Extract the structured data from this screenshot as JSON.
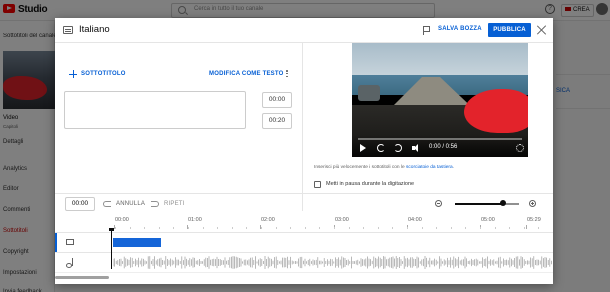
{
  "app": {
    "brand": "Studio",
    "search_placeholder": "Cerca in tutto il tuo canale",
    "help_icon": "?",
    "create_label": "CREA"
  },
  "sidebar": {
    "title": "Sottotitoli del canale",
    "video_label": "Video",
    "video_sub": "Capitoli",
    "items": [
      {
        "label": "Dettagli",
        "active": false
      },
      {
        "label": "Analytics",
        "active": false
      },
      {
        "label": "Editor",
        "active": false
      },
      {
        "label": "Commenti",
        "active": false
      },
      {
        "label": "Sottotitoli",
        "active": true
      },
      {
        "label": "Copyright",
        "active": false
      },
      {
        "label": "Impostazioni",
        "active": false
      },
      {
        "label": "Invia feedback",
        "active": false
      }
    ]
  },
  "background_right": {
    "link": "SICA"
  },
  "modal": {
    "title": "Italiano",
    "save_draft": "SALVA BOZZA",
    "publish": "PUBBLICA",
    "add_subtitle": "SOTTOTITOLO",
    "edit_as_text": "MODIFICA COME TESTO",
    "start_time": "00:00",
    "end_time": "00:20"
  },
  "player": {
    "time": "0:00 / 0:56",
    "hint_prefix": "Inserisci più velocemente i sottotitoli con le",
    "hint_link": "scorciatoie da tastiera",
    "hint_suffix": ".",
    "pause_while_typing": "Metti in pausa durante la digitazione",
    "pause_checked": false
  },
  "toolbar": {
    "current_time": "00:00",
    "undo": "ANNULLA",
    "redo": "RIPETI",
    "zoom_level": 0.75
  },
  "timeline": {
    "ticks": [
      {
        "label": "00:00"
      },
      {
        "label": "01:00"
      },
      {
        "label": "02:00"
      },
      {
        "label": "03:00"
      },
      {
        "label": "04:00"
      },
      {
        "label": "05:00"
      },
      {
        "label": "05:29"
      }
    ]
  },
  "colors": {
    "accent": "#065fd4",
    "brand_red": "#ff0000",
    "subtitle_clip": "#1565d8"
  }
}
